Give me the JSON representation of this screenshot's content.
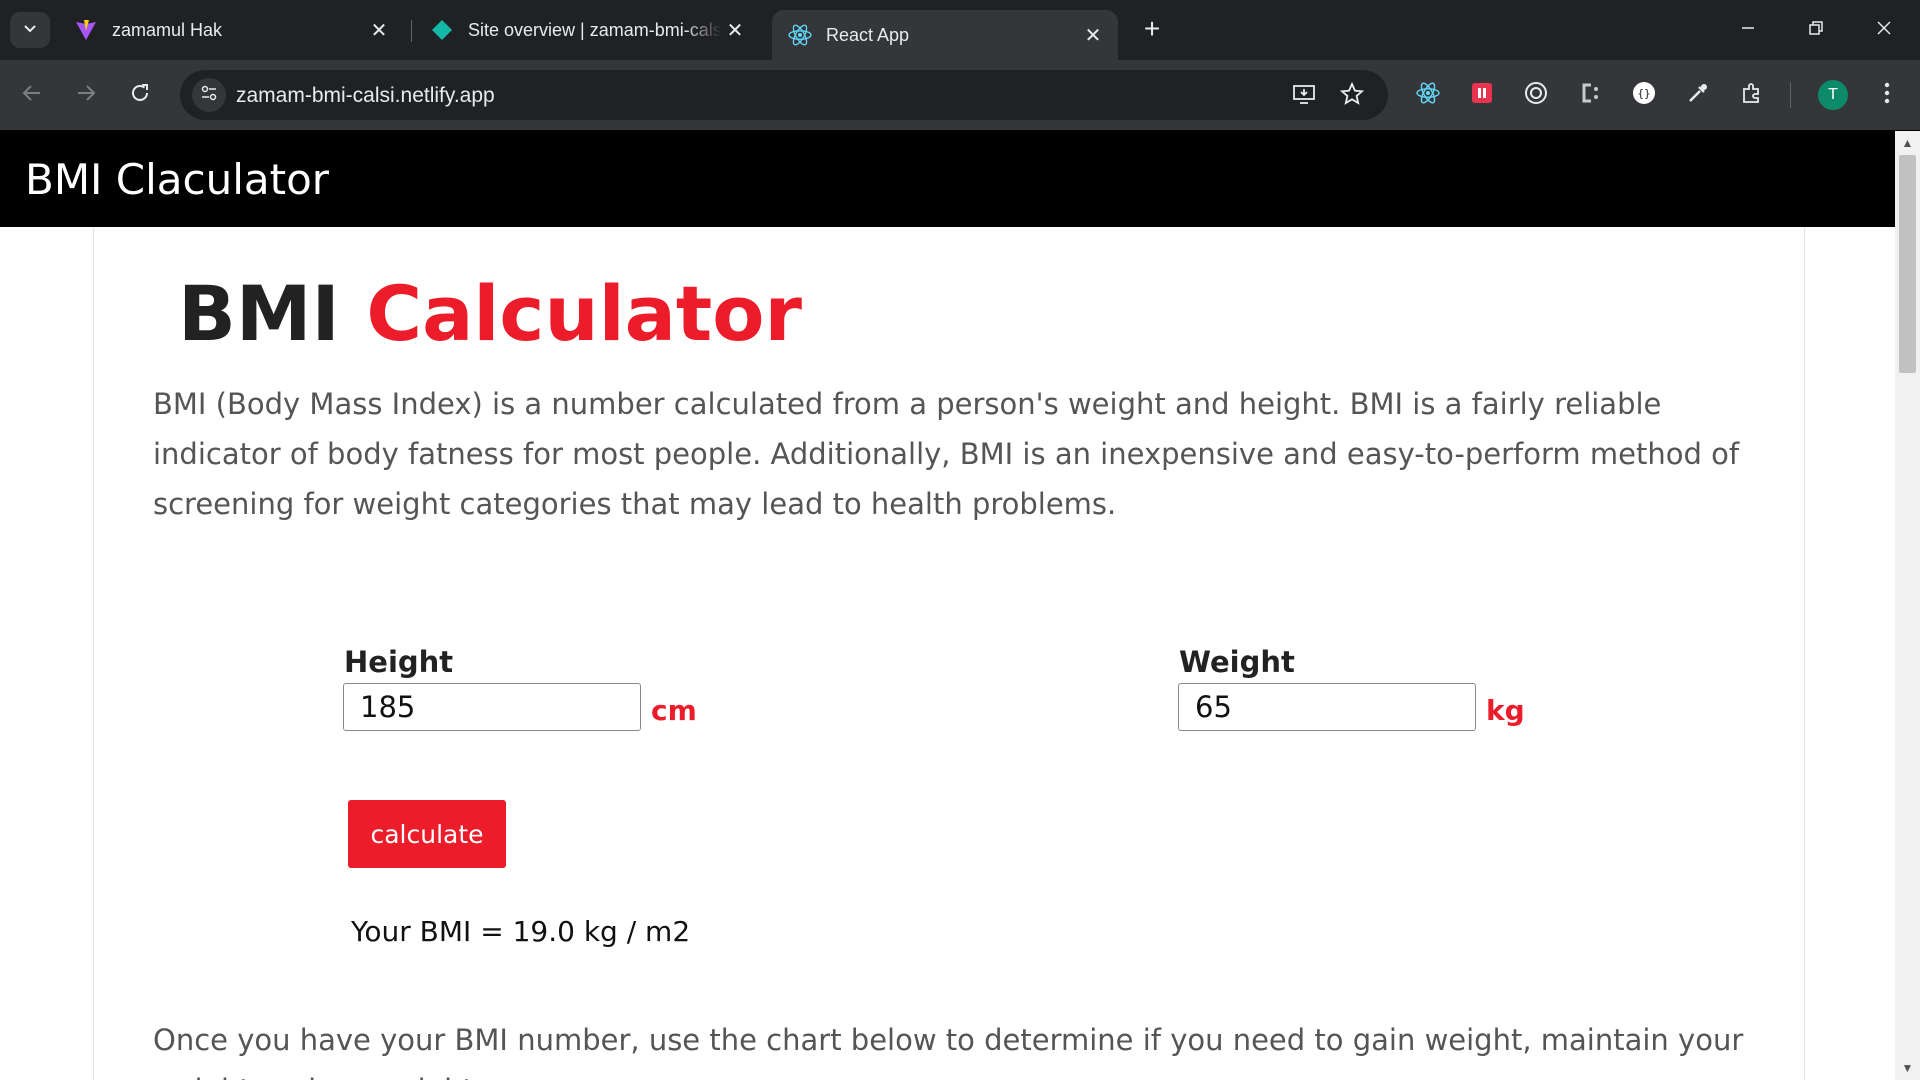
{
  "browser": {
    "tabs": [
      {
        "title": "zamamul Hak",
        "icon": "vite-icon",
        "active": false
      },
      {
        "title": "Site overview | zamam-bmi-calsi",
        "icon": "netlify-icon",
        "active": false
      },
      {
        "title": "React App",
        "icon": "react-icon",
        "active": true
      }
    ],
    "url": "zamam-bmi-calsi.netlify.app",
    "profile_initial": "T",
    "colors": {
      "tabstrip": "#202124",
      "toolbar": "#35363a",
      "profile": "#0c8a6a"
    }
  },
  "page": {
    "navbar": {
      "brand": "BMI Claculator"
    },
    "heading": {
      "part1": "BMI",
      "part2": "Calculator"
    },
    "intro": "BMI (Body Mass Index) is a number calculated from a person's weight and height. BMI is a fairly reliable indicator of body fatness for most people. Additionally, BMI is an inexpensive and easy-to-perform method of screening for weight categories that may lead to health problems.",
    "height": {
      "label": "Height",
      "value": "185",
      "unit": "cm"
    },
    "weight": {
      "label": "Weight",
      "value": "65",
      "unit": "kg"
    },
    "calculate_label": "calculate",
    "result": {
      "prefix": "Your BMI =",
      "value": "19.0",
      "suffix": "kg / m2"
    },
    "outro": "Once you have your BMI number, use the chart below to determine if you need to gain weight, maintain your weight, or lose weight.",
    "colors": {
      "accent": "#ed1c2a",
      "navbar": "#000000"
    }
  }
}
